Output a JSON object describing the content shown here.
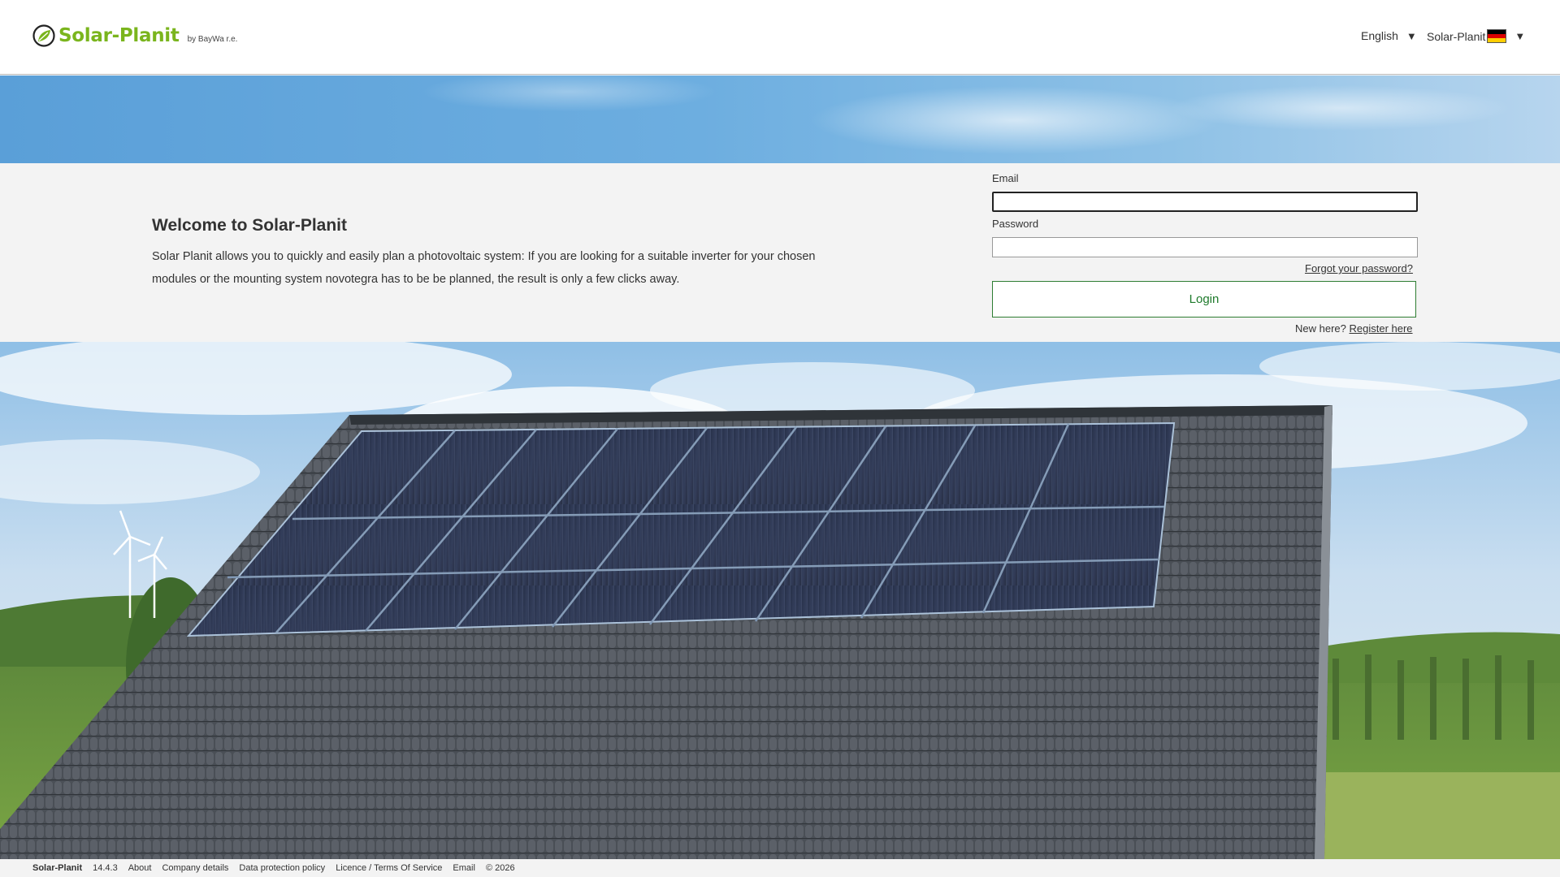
{
  "header": {
    "logo_text": "Solar-Planit",
    "logo_by": "by BayWa r.e.",
    "language_label": "English",
    "brand_label": "Solar-Planit",
    "caret": "▼",
    "colors": {
      "logo_green": "#7ab51d",
      "login_green": "#1e7a2b"
    }
  },
  "welcome": {
    "title": "Welcome to Solar-Planit",
    "text": "Solar Planit allows you to quickly and easily plan a photovoltaic system: If you are looking for a suitable inverter for your chosen modules or the mounting system novotegra has to be be planned, the result is only a few clicks away."
  },
  "login": {
    "email_label": "Email",
    "email_value": "",
    "password_label": "Password",
    "password_value": "",
    "forgot_label": "Forgot your password?",
    "login_button": "Login",
    "new_here": "New here?",
    "register_label": "Register here"
  },
  "footer": {
    "brand": "Solar-Planit",
    "version": "14.4.3",
    "links": [
      "About",
      "Company details",
      "Data protection policy",
      "Licence / Terms Of Service",
      "Email"
    ],
    "copyright": "© 2026"
  }
}
